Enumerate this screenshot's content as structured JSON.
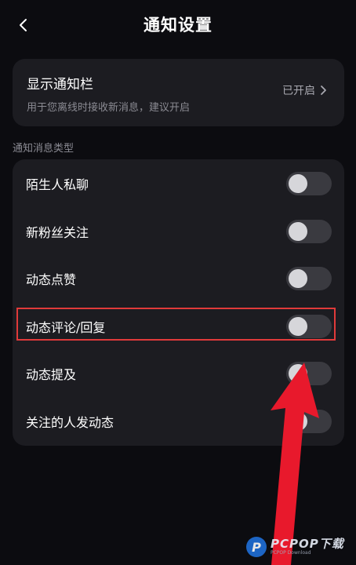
{
  "header": {
    "title": "通知设置",
    "back_icon": "chevron-left-icon"
  },
  "banner": {
    "title": "显示通知栏",
    "subtitle": "用于您离线时接收新消息，建议开启",
    "status": "已开启",
    "chevron_icon": "chevron-right-icon"
  },
  "section": {
    "label": "通知消息类型"
  },
  "toggles": [
    {
      "label": "陌生人私聊",
      "on": false
    },
    {
      "label": "新粉丝关注",
      "on": false
    },
    {
      "label": "动态点赞",
      "on": false
    },
    {
      "label": "动态评论/回复",
      "on": false,
      "highlighted": true
    },
    {
      "label": "动态提及",
      "on": false
    },
    {
      "label": "关注的人发动态",
      "on": false
    }
  ],
  "annotation": {
    "arrow_color": "#e8192c",
    "highlight_color": "#e03a3a"
  },
  "watermark": {
    "logo": "P",
    "main": "PCPOP下载",
    "sub": "PCPOP Download"
  },
  "colors": {
    "background": "#0c0c10",
    "card": "#1c1c21",
    "toggle_off": "#3a3a40"
  }
}
